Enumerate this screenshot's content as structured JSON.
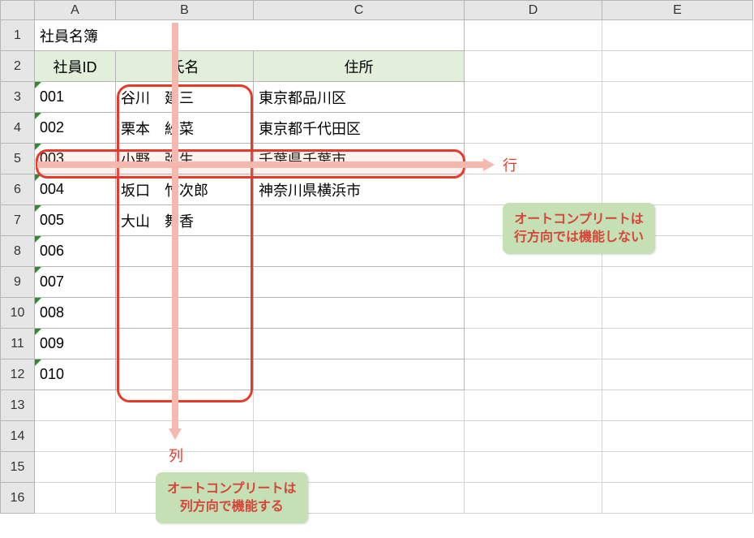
{
  "columns": [
    "A",
    "B",
    "C",
    "D",
    "E"
  ],
  "row_numbers": [
    "1",
    "2",
    "3",
    "4",
    "5",
    "6",
    "7",
    "8",
    "9",
    "10",
    "11",
    "12",
    "13",
    "14",
    "15",
    "16"
  ],
  "title": "社員名簿",
  "headers": {
    "id": "社員ID",
    "name": "氏名",
    "addr": "住所"
  },
  "rows": [
    {
      "id": "001",
      "name": "谷川　建三",
      "addr": "東京都品川区"
    },
    {
      "id": "002",
      "name": "栗本　紗菜",
      "addr": "東京都千代田区"
    },
    {
      "id": "003",
      "name": "小野　弥生",
      "addr": "千葉県千葉市"
    },
    {
      "id": "004",
      "name": "坂口　竹次郎",
      "addr": "神奈川県横浜市"
    },
    {
      "id": "005",
      "name": "大山　舞香",
      "addr": ""
    },
    {
      "id": "006",
      "name": "",
      "addr": ""
    },
    {
      "id": "007",
      "name": "",
      "addr": ""
    },
    {
      "id": "008",
      "name": "",
      "addr": ""
    },
    {
      "id": "009",
      "name": "",
      "addr": ""
    },
    {
      "id": "010",
      "name": "",
      "addr": ""
    }
  ],
  "annotations": {
    "row_label": "行",
    "col_label": "列",
    "callout_row": "オートコンプリートは\n行方向では機能しない",
    "callout_col": "オートコンプリートは\n列方向で機能する"
  }
}
